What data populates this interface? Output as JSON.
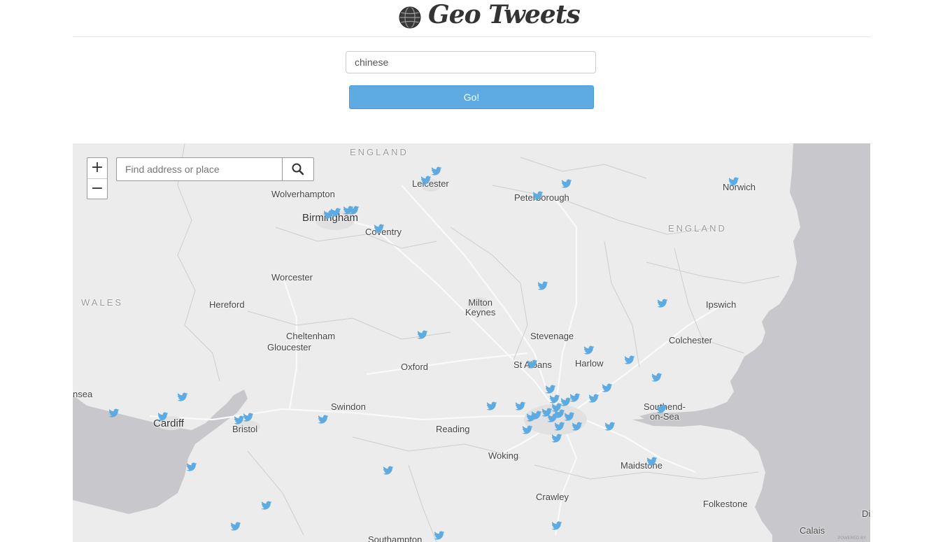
{
  "header": {
    "title": "Geo Tweets",
    "logo_icon": "globe-icon"
  },
  "search": {
    "value": "chinese",
    "button_label": "Go!"
  },
  "map": {
    "zoom_in": "+",
    "zoom_out": "−",
    "geocoder_placeholder": "Find address or place",
    "geocoder_icon": "search-icon",
    "marker_icon": "twitter-bird-icon",
    "marker_color": "#5dabe0",
    "water_color": "#c8c8cc",
    "land_color": "#ececec",
    "credit": "POWERED BY",
    "places": {
      "england_n": "ENGLAND",
      "england_e": "ENGLAND",
      "wales": "WALES",
      "wolverhampton": "Wolverhampton",
      "leicester": "Leicester",
      "peterborough": "Peterborough",
      "norwich": "Norwich",
      "birmingham": "Birmingham",
      "coventry": "Coventry",
      "worcester": "Worcester",
      "hereford": "Hereford",
      "milton_keynes_1": "Milton",
      "milton_keynes_2": "Keynes",
      "ipswich": "Ipswich",
      "cheltenham": "Cheltenham",
      "gloucester": "Gloucester",
      "stevenage": "Stevenage",
      "colchester": "Colchester",
      "oxford": "Oxford",
      "st_albans": "St Albans",
      "harlow": "Harlow",
      "swansea": "nsea",
      "swindon": "Swindon",
      "cardiff": "Cardiff",
      "bristol": "Bristol",
      "reading": "Reading",
      "southend_1": "Southend-",
      "southend_2": "on-Sea",
      "woking": "Woking",
      "maidstone": "Maidstone",
      "crawley": "Crawley",
      "folkestone": "Folkestone",
      "calais": "Calais",
      "southampton": "Southampton",
      "dunkirk": "Di"
    }
  }
}
